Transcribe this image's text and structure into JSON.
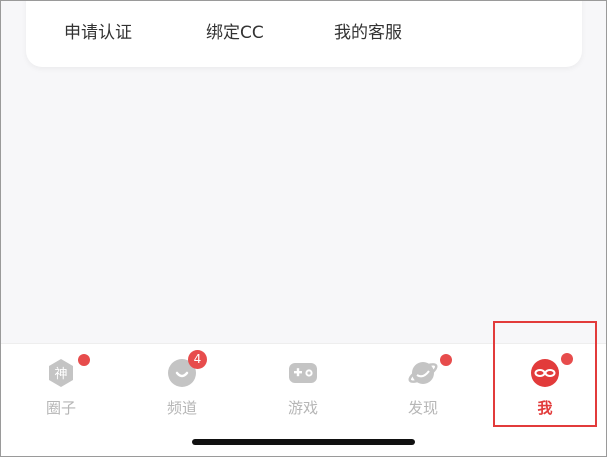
{
  "card": {
    "items": [
      {
        "label": "申请认证"
      },
      {
        "label": "绑定CC"
      },
      {
        "label": "我的客服"
      }
    ]
  },
  "tabbar": {
    "tabs": [
      {
        "label": "圈子",
        "icon": "hexagon-god-icon",
        "dot": true
      },
      {
        "label": "频道",
        "icon": "chat-bubble-icon",
        "badge": "4"
      },
      {
        "label": "游戏",
        "icon": "gamepad-icon"
      },
      {
        "label": "发现",
        "icon": "planet-icon",
        "dot": true
      },
      {
        "label": "我",
        "icon": "mask-face-icon",
        "dot": true,
        "active": true
      }
    ]
  },
  "colors": {
    "accent": "#e23b3b",
    "inactive": "#b6b6b6",
    "background": "#f7f7f9"
  }
}
